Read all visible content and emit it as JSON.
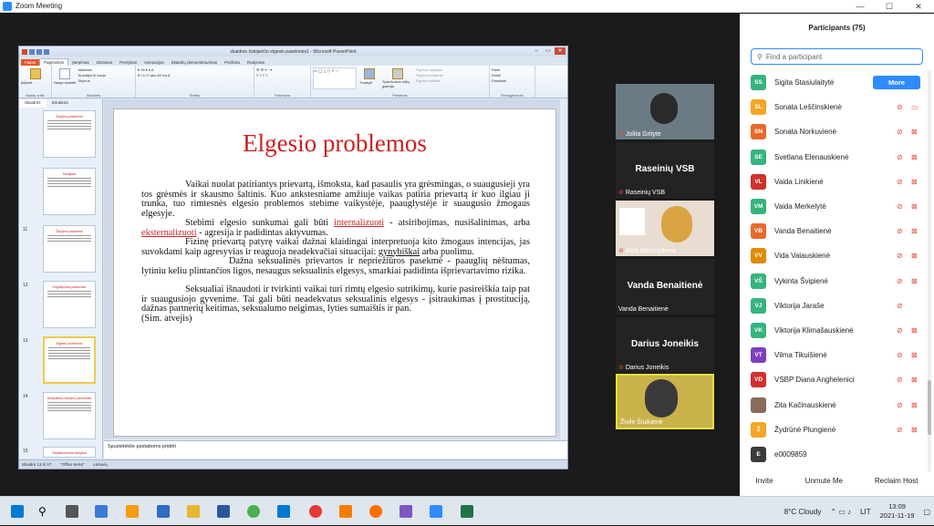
{
  "window": {
    "title": "Zoom Meeting",
    "minimize": "—",
    "maximize": "☐",
    "close": "✕"
  },
  "ppt": {
    "title": "skaidres žalojančio elgesio pasekmės1 - Microsoft PowerPoint",
    "tabs": [
      "Failas",
      "Pagrindinis",
      "Įterpimas",
      "Dizainas",
      "Perėjimai",
      "Animacijos",
      "Skaidrių demonstravimas",
      "Peržiūra",
      "Rodymas"
    ],
    "ribbon": {
      "paste": "Įklijuoti",
      "new_slide": "Nauja skaidrė",
      "layout": "Maketas",
      "reset": "Nustatyti iš naujo",
      "section": "Skyrius",
      "arrange": "Tvarkyti",
      "quick_styles": "Sparčiosios stilių galerija",
      "shape_fill": "Figūros užpildas",
      "shape_outline": "Figūros kontūras",
      "shape_effects": "Figūros efektai",
      "find": "Rasti",
      "replace": "Keisti",
      "select": "Pasirinkti",
      "groups": [
        "Mainų sritis",
        "Skaidrės",
        "Šriftas",
        "Pastraipa",
        "Piešimas",
        "Redagavimas"
      ]
    },
    "pane_tabs": [
      "Skaidrės",
      "Struktūra"
    ],
    "thumbnails": [
      {
        "num": "",
        "title": "Žalojimų padariniai"
      },
      {
        "num": "",
        "title": "Savijauta"
      },
      {
        "num": "11",
        "title": "Žalojimo padariniai"
      },
      {
        "num": "12",
        "title": "Kognityvinės pasekmės"
      },
      {
        "num": "13",
        "title": "Elgesio problemos"
      },
      {
        "num": "14",
        "title": "Seksualinio žalojimo pasekmės"
      },
      {
        "num": "15",
        "title": "Tarpasmeniniai santykiai"
      }
    ],
    "slide": {
      "title": "Elgesio problemos",
      "p1": "Vaikai nuolat patiriantys prievartą, išmoksta, kad pasaulis yra grėsmingas, o suaugusieji yra tos grėsmės ir skausmo šaltinis. Kuo ankstesniame amžiuje vaikas patiria prievartą ir kuo ilgiau ji trunka, tuo rimtesnės elgesio problemos stebime vaikystėje, paauglystėje ir suaugusio žmogaus elgesyje.",
      "p2a": "Stebimi elgesio sunkumai gali būti",
      "p2_int": "internalizuoti",
      "p2b": "- atsiribojimas, nusišalinimas, arba",
      "p2_ext": "eksternalizuoti",
      "p2c": "- agresija ir padidintas aktyvumas.",
      "p3a": "Fizinę prievartą patyrę vaikai dažnai klaidingai interpretuoja kito žmogaus intencijas, jas suvokdami kaip agresyvias ir reaguoja neadekvačiai situacijai:",
      "p3_gyn": "gynybiškai",
      "p3b": "arba puolimu.",
      "p4": "Dažna seksualinės prievartos ir nepriežiūros pasekmė - paauglių nėštumas, lytiniu keliu plintančios ligos, nesaugus seksualinis elgesys, smarkiai padidinta išprievartavimo rizika.",
      "p5": "Seksualiai išnaudoti ir tvirkinti vaikai turi rimtų elgesio sutrikimų, kurie pasireiškia taip pat ir suaugusiojo gyvenime. Tai gali būti neadekvatus seksualinis elgesys - įsitraukimas į prostituciją, dažnas partnerių keitimas, seksualumo neigimas, lyties sumaištis ir pan.",
      "p6": "(Sim. atvejis)"
    },
    "notes_placeholder": "Spustelėkite pastaboms pridėti",
    "status": {
      "slide": "Skaidrė 13 iš 17",
      "theme": "\"Office tema\"",
      "lang": "Lietuvių"
    }
  },
  "videos": [
    {
      "name": "Jolita Grityte",
      "label": ""
    },
    {
      "name": "Raseinių VSB",
      "label": "Raseinių VSB"
    },
    {
      "name": "Asta Montvydienė",
      "label": ""
    },
    {
      "name": "Vanda Benaitienė",
      "label": "Vanda Benaitienė"
    },
    {
      "name": "Darius Joneikis",
      "label": "Darius Joneikis"
    },
    {
      "name": "Živilė Šiuikienė",
      "label": ""
    }
  ],
  "participants": {
    "header": "Participants (75)",
    "search_placeholder": "Find a participant",
    "more_label": "More",
    "list": [
      {
        "initials": "SS",
        "name": "Sigita Stasiulaitytė",
        "color": "#36b37e"
      },
      {
        "initials": "SL",
        "name": "Sonata Leščinskienė",
        "color": "#f5a623"
      },
      {
        "initials": "SN",
        "name": "Sonata Norkuvienė",
        "color": "#e8692a"
      },
      {
        "initials": "SE",
        "name": "Svetlana Elenauskienė",
        "color": "#36b37e"
      },
      {
        "initials": "VL",
        "name": "Vaida Linikienė",
        "color": "#d0312d"
      },
      {
        "initials": "VM",
        "name": "Vaida Merkelytė",
        "color": "#36b37e"
      },
      {
        "initials": "VB",
        "name": "Vanda Benaitienė",
        "color": "#e8692a"
      },
      {
        "initials": "VV",
        "name": "Vida Valauskienė",
        "color": "#e08a00"
      },
      {
        "initials": "VŠ",
        "name": "Vykinta Švipienė",
        "color": "#36b37e"
      },
      {
        "initials": "VJ",
        "name": "Viktorija Jaraše",
        "color": "#36b37e"
      },
      {
        "initials": "VK",
        "name": "Viktorija Klimašauskienė",
        "color": "#36b37e"
      },
      {
        "initials": "VT",
        "name": "Vilma Tikuišienė",
        "color": "#7b3fbf"
      },
      {
        "initials": "VD",
        "name": "VSBP Diana Anghelenici",
        "color": "#d0312d"
      },
      {
        "initials": "",
        "name": "Zita Kačinauskienė",
        "color": "#8a6a5a"
      },
      {
        "initials": "Ž",
        "name": "Žydrūnė Plungienė",
        "color": "#f5a623"
      },
      {
        "initials": "E",
        "name": "e0009859",
        "color": "#3a3a3a"
      }
    ],
    "footer": {
      "invite": "Invite",
      "unmute": "Unmute Me",
      "reclaim": "Reclaim Host"
    }
  },
  "taskbar": {
    "weather": "8°C Cloudy",
    "lang": "LIT",
    "time": "13:09",
    "date": "2021-11-19"
  }
}
